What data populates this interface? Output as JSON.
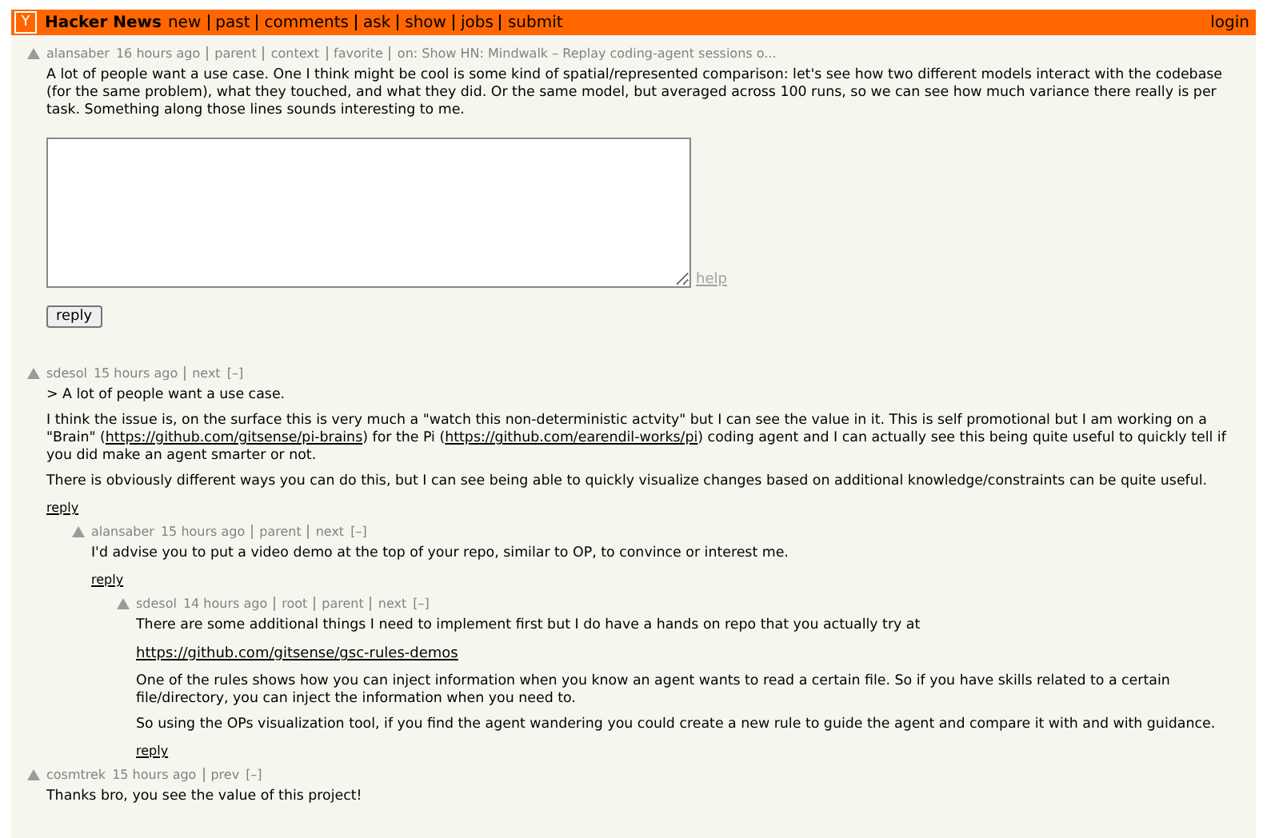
{
  "header": {
    "logo": "Y",
    "title": "Hacker News",
    "nav": [
      "new",
      "past",
      "comments",
      "ask",
      "show",
      "jobs",
      "submit"
    ],
    "login": "login"
  },
  "parent": {
    "user": "alansaber",
    "age": "16 hours ago",
    "links": [
      "parent",
      "context",
      "favorite"
    ],
    "on": "on: Show HN: Mindwalk – Replay coding-agent sessions o...",
    "paragraphs": [
      [
        {
          "text": "A lot of people want a use case. One I think might be cool is some kind of spatial/represented comparison: let's see how two different models interact with the codebase (for the same problem), what they touched, and what they did. Or the same model, but averaged across 100 runs, so we can see how much variance there really is per task. Something along those lines sounds interesting to me."
        }
      ]
    ]
  },
  "reply_form": {
    "help": "help",
    "button": "reply"
  },
  "comments": [
    {
      "user": "sdesol",
      "age": "15 hours ago",
      "links": [
        "next"
      ],
      "toggle": "[–]",
      "reply": "reply",
      "paragraphs": [
        [
          {
            "text": "> A lot of people want a use case."
          }
        ],
        [
          {
            "text": "I think the issue is, on the surface this is very much a \"watch this non-deterministic actvity\" but I can see the value in it. This is self promotional but I am working on a \"Brain\" ("
          },
          {
            "link": "https://github.com/gitsense/pi-brains"
          },
          {
            "text": ") for the Pi ("
          },
          {
            "link": "https://github.com/earendil-works/pi"
          },
          {
            "text": ") coding agent and I can actually see this being quite useful to quickly tell if you did make an agent smarter or not."
          }
        ],
        [
          {
            "text": "There is obviously different ways you can do this, but I can see being able to quickly visualize changes based on additional knowledge/constraints can be quite useful."
          }
        ]
      ],
      "children": [
        {
          "user": "alansaber",
          "age": "15 hours ago",
          "links": [
            "parent",
            "next"
          ],
          "toggle": "[–]",
          "reply": "reply",
          "paragraphs": [
            [
              {
                "text": "I'd advise you to put a video demo at the top of your repo, similar to OP, to convince or interest me."
              }
            ]
          ],
          "children": [
            {
              "user": "sdesol",
              "age": "14 hours ago",
              "links": [
                "root",
                "parent",
                "next"
              ],
              "toggle": "[–]",
              "reply": "reply",
              "paragraphs": [
                [
                  {
                    "text": "There are some additional things I need to implement first but I do have a hands on repo that you actually try at"
                  }
                ],
                [
                  {
                    "link": "https://github.com/gitsense/gsc-rules-demos"
                  }
                ],
                [
                  {
                    "text": "One of the rules shows how you can inject information when you know an agent wants to read a certain file. So if you have skills related to a certain file/directory, you can inject the information when you need to."
                  }
                ],
                [
                  {
                    "text": "So using the OPs visualization tool, if you find the agent wandering you could create a new rule to guide the agent and compare it with and with guidance."
                  }
                ]
              ]
            }
          ]
        }
      ]
    },
    {
      "user": "cosmtrek",
      "age": "15 hours ago",
      "links": [
        "prev"
      ],
      "toggle": "[–]",
      "paragraphs": [
        [
          {
            "text": "Thanks bro, you see the value of this project!"
          }
        ]
      ]
    }
  ]
}
